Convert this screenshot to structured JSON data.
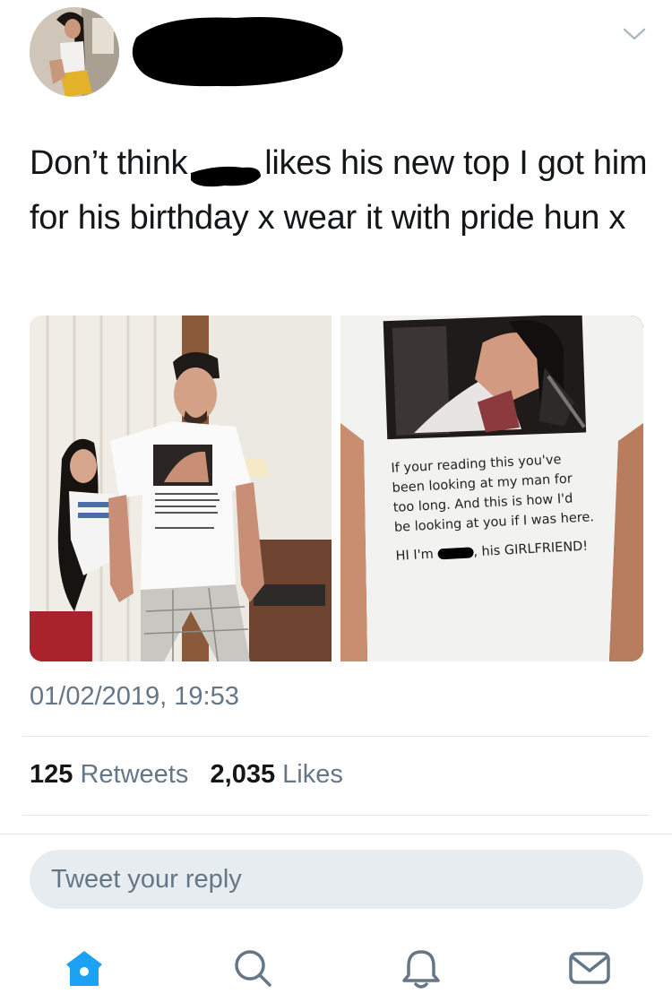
{
  "tweet": {
    "text_before": "Don’t think",
    "text_after": "likes his new top I got him for his birthday x wear it with pride hun x",
    "timestamp": "01/02/2019, 19:53",
    "retweets_count": "125",
    "retweets_label": "Retweets",
    "likes_count": "2,035",
    "likes_label": "Likes"
  },
  "shirt_print": {
    "line1": "If your reading this you've",
    "line2": "been looking at my man for",
    "line3": "too long. And this is how I'd",
    "line4": "be looking at you if I was here.",
    "line5a": "HI I'm",
    "line5b": ", his GIRLFRIEND!"
  },
  "reply": {
    "placeholder": "Tweet your reply"
  },
  "icons": {
    "home": "home-icon",
    "search": "search-icon",
    "notifications": "bell-icon",
    "messages": "mail-icon",
    "more": "chevron-down-icon"
  },
  "colors": {
    "accent": "#1da1f2",
    "muted": "#657786",
    "text": "#14171a",
    "divider": "#e1e8ed"
  }
}
